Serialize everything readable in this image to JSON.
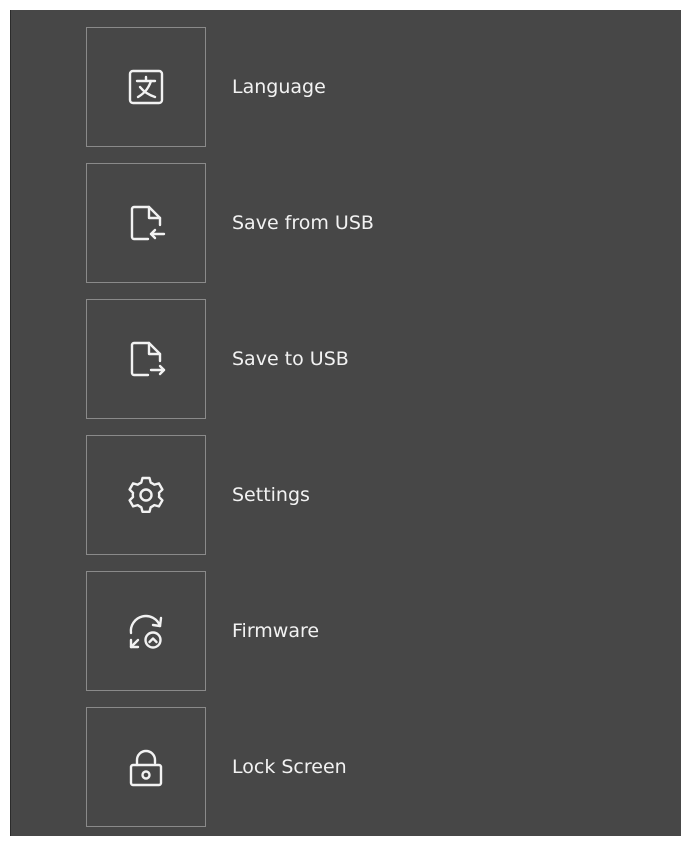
{
  "menu": {
    "items": [
      {
        "label": "Language",
        "icon": "language-icon"
      },
      {
        "label": "Save from USB",
        "icon": "file-import-icon"
      },
      {
        "label": "Save to USB",
        "icon": "file-export-icon"
      },
      {
        "label": "Settings",
        "icon": "gear-icon"
      },
      {
        "label": "Firmware",
        "icon": "firmware-update-icon"
      },
      {
        "label": "Lock Screen",
        "icon": "lock-icon"
      }
    ]
  },
  "colors": {
    "background": "#474747",
    "icon_border": "#8a8a8a",
    "text": "#f2f2f2"
  }
}
